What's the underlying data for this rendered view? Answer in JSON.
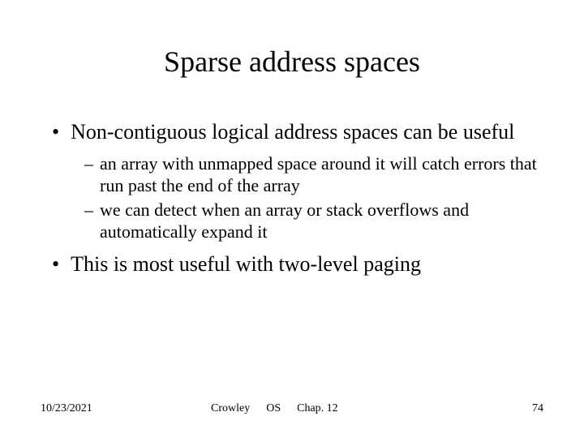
{
  "title": "Sparse address spaces",
  "bullets": [
    {
      "text": "Non-contiguous logical address spaces can be useful",
      "children": [
        "an array with unmapped space around it will catch errors that run past the end of the array",
        "we can detect when an array or stack overflows and automatically expand it"
      ]
    },
    {
      "text": "This is most useful with two-level paging",
      "children": []
    }
  ],
  "footer": {
    "date": "10/23/2021",
    "author": "Crowley",
    "course": "OS",
    "chapter": "Chap. 12",
    "page": "74"
  },
  "markers": {
    "bullet": "•",
    "dash": "–"
  }
}
